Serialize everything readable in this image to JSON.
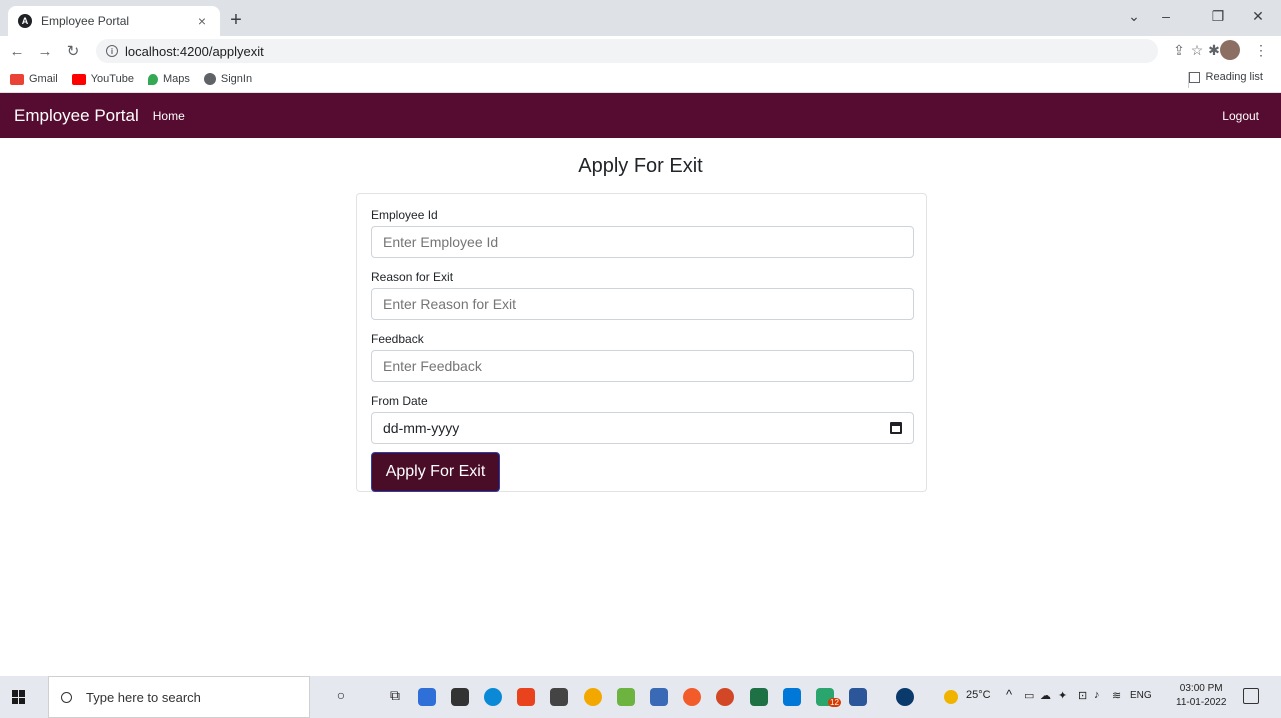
{
  "browser": {
    "tab_title": "Employee Portal",
    "tab_favicon": "A",
    "tab_close": "×",
    "new_tab": "+",
    "url": "localhost:4200/applyexit",
    "bookmarks": [
      {
        "label": "Gmail",
        "color": "#ea4335"
      },
      {
        "label": "YouTube",
        "color": "#ff0000"
      },
      {
        "label": "Maps",
        "color": "#34a853"
      },
      {
        "label": "SignIn",
        "color": "#5f6368"
      }
    ],
    "reading_list": "Reading list"
  },
  "navbar": {
    "brand": "Employee Portal",
    "home": "Home",
    "logout": "Logout",
    "bg_color": "#560c30"
  },
  "page": {
    "title": "Apply For Exit"
  },
  "form": {
    "employee_id": {
      "label": "Employee Id",
      "placeholder": "Enter Employee Id"
    },
    "reason": {
      "label": "Reason for Exit",
      "placeholder": "Enter Reason for Exit"
    },
    "feedback": {
      "label": "Feedback",
      "placeholder": "Enter Feedback"
    },
    "from_date": {
      "label": "From Date",
      "placeholder": "dd-mm-yyyy"
    },
    "submit": "Apply For Exit"
  },
  "taskbar": {
    "search_placeholder": "Type here to search",
    "weather": "25°C",
    "language": "ENG",
    "time": "03:00 PM",
    "date": "11-01-2022",
    "badge_count": "12"
  }
}
